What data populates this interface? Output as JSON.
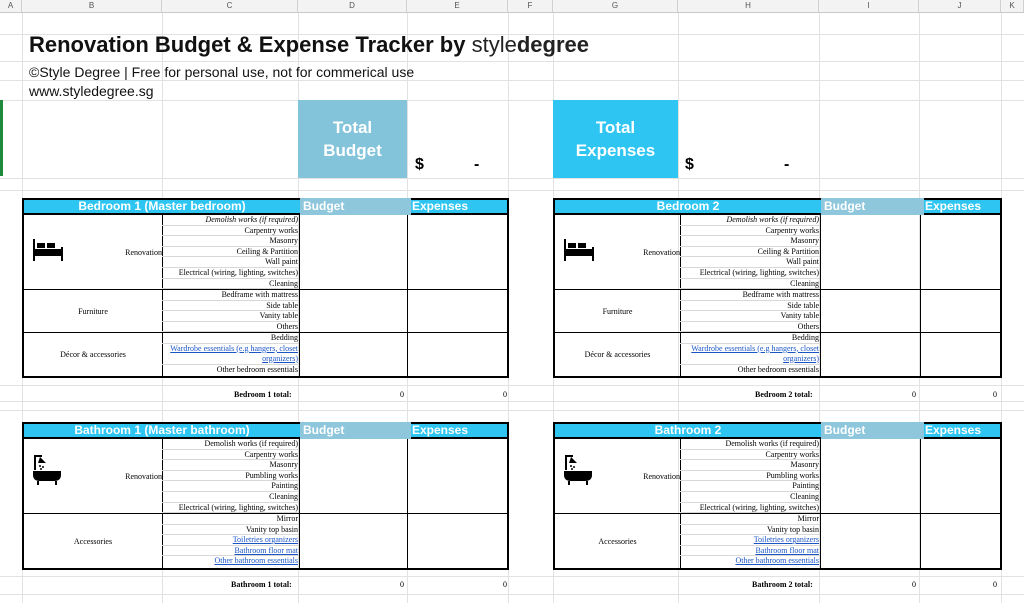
{
  "columns": [
    "A",
    "B",
    "C",
    "D",
    "E",
    "F",
    "G",
    "H",
    "I",
    "J",
    "K"
  ],
  "title": {
    "main": "Renovation Budget & Expense Tracker by ",
    "brand_light": "style",
    "brand_bold": "degree"
  },
  "copyright": "©Style Degree  |  Free for personal use, not for commerical use",
  "website": "www.styledegree.sg",
  "kpis": {
    "budget": {
      "label_line1": "Total",
      "label_line2": "Budget",
      "currency": "$",
      "value": "-",
      "color": "#84c4da"
    },
    "expenses": {
      "label_line1": "Total",
      "label_line2": "Expenses",
      "currency": "$",
      "value": "-",
      "color": "#2ec5f2"
    }
  },
  "col_budget": "Budget",
  "col_expenses": "Expenses",
  "colors": {
    "header_blue": "#2ec5f2",
    "header_budget": "#8ec7dc",
    "link": "#1a55c6"
  },
  "bedroom1": {
    "title": "Bedroom 1 (Master bedroom)",
    "renovation": {
      "label": "Renovation",
      "icon": "bed-icon",
      "items": [
        "Demolish works (if required)",
        "Carpentry works",
        "Masonry",
        "Ceiling & Partition",
        "Wall paint",
        "Electrical (wiring, lighting, switches)",
        "Cleaning"
      ]
    },
    "furniture": {
      "label": "Furniture",
      "items": [
        "Bedframe with mattress",
        "Side table",
        "Vanity table",
        "Others"
      ]
    },
    "decor": {
      "label": "Décor & accessories",
      "items": [
        "Bedding",
        "Wardrobe essentials (e.g hangers, closet organizers)",
        "Other bedroom essentials"
      ]
    },
    "total_label": "Bedroom 1 total:",
    "total_budget": "0",
    "total_expenses": "0"
  },
  "bedroom2": {
    "title": "Bedroom 2",
    "renovation": {
      "label": "Renovation",
      "icon": "bed-icon",
      "items": [
        "Demolish works (if required)",
        "Carpentry works",
        "Masonry",
        "Ceiling & Partition",
        "Wall paint",
        "Electrical (wiring, lighting, switches)",
        "Cleaning"
      ]
    },
    "furniture": {
      "label": "Furniture",
      "items": [
        "Bedframe with mattress",
        "Side table",
        "Vanity table",
        "Others"
      ]
    },
    "decor": {
      "label": "Décor & accessories",
      "items": [
        "Bedding",
        "Wardrobe essentials (e.g hangers, closet organizers)",
        "Other bedroom essentials"
      ]
    },
    "total_label": "Bedroom 2 total:",
    "total_budget": "0",
    "total_expenses": "0"
  },
  "bathroom1": {
    "title": "Bathroom 1 (Master bathroom)",
    "renovation": {
      "label": "Renovation",
      "icon": "bathtub-icon",
      "items": [
        "Demolish works (if required)",
        "Carpentry works",
        "Masonry",
        "Pumbling works",
        "Painting",
        "Cleaning",
        "Electrical (wiring, lighting, switches)"
      ]
    },
    "accessories": {
      "label": "Accessories",
      "items": [
        "Mirror",
        "Vanity top basin",
        "Toiletries organizers",
        "Bathroom floor mat",
        "Other  bathroom essentials"
      ]
    },
    "total_label": "Bathroom 1 total:",
    "total_budget": "0",
    "total_expenses": "0"
  },
  "bathroom2": {
    "title": "Bathroom 2",
    "renovation": {
      "label": "Renovation",
      "icon": "bathtub-icon",
      "items": [
        "Demolish works (if required)",
        "Carpentry works",
        "Masonry",
        "Pumbling works",
        "Painting",
        "Cleaning",
        "Electrical (wiring, lighting, switches)"
      ]
    },
    "accessories": {
      "label": "Accessories",
      "items": [
        "Mirror",
        "Vanity top basin",
        "Toiletries organizers",
        "Bathroom floor mat",
        "Other  bathroom essentials"
      ]
    },
    "total_label": "Bathroom 2 total:",
    "total_budget": "0",
    "total_expenses": "0"
  }
}
